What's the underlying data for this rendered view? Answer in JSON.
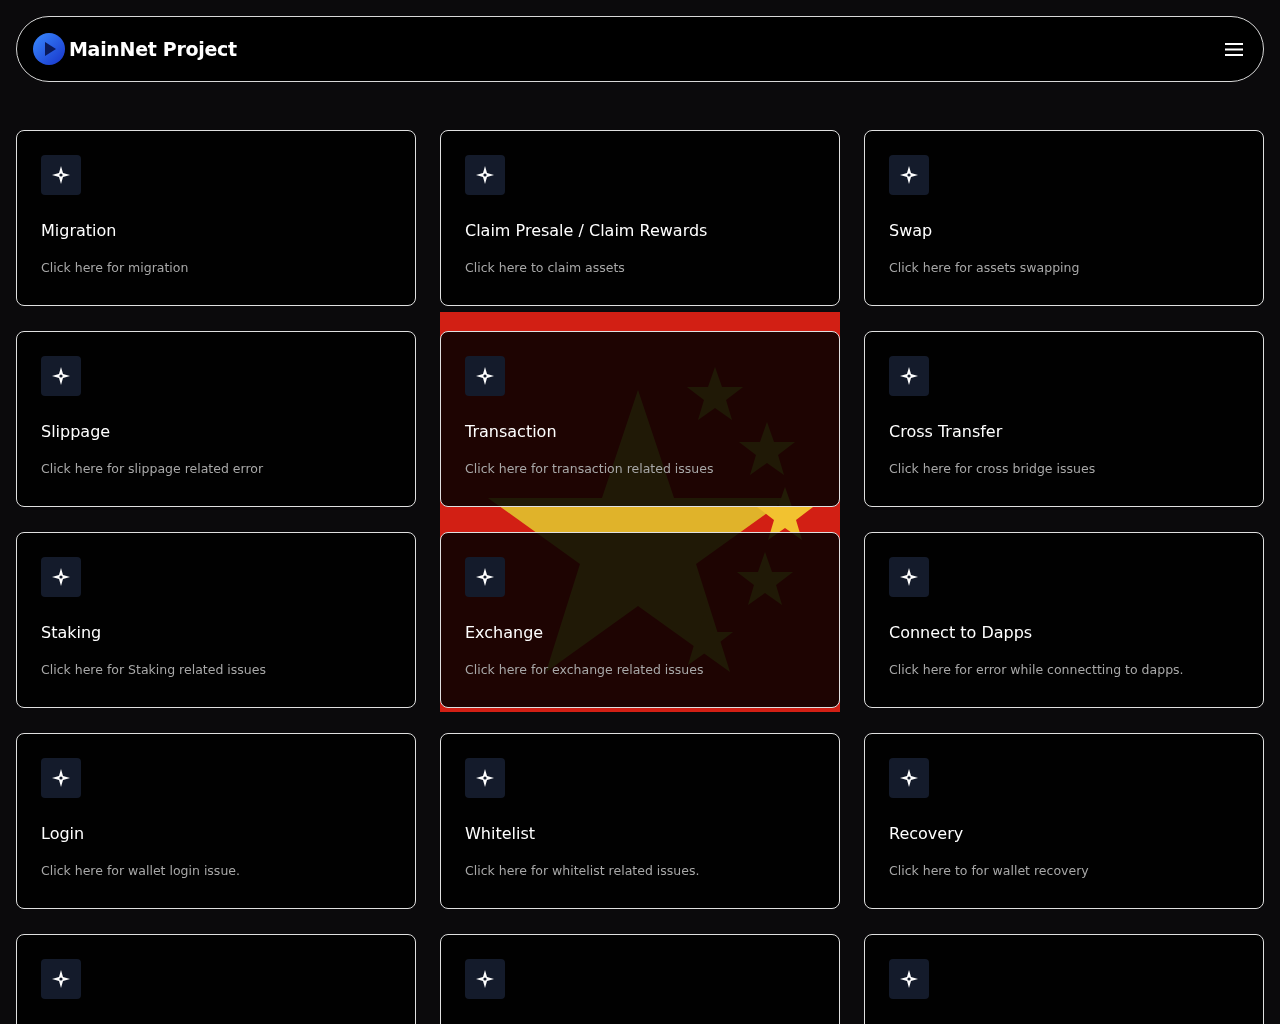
{
  "header": {
    "brand": "MainNet Project"
  },
  "cards": [
    {
      "kind": "text",
      "title": "Migration",
      "description": "Click here for migration"
    },
    {
      "kind": "text",
      "title": "Claim Presale / Claim Rewards",
      "description": "Click here to claim assets"
    },
    {
      "kind": "text",
      "title": "Swap",
      "description": "Click here for assets swapping"
    },
    {
      "kind": "text",
      "title": "Slippage",
      "description": "Click here for slippage related error"
    },
    {
      "kind": "text",
      "title": "Transaction",
      "description": "Click here for transaction related issues"
    },
    {
      "kind": "text",
      "title": "Cross Transfer",
      "description": "Click here for cross bridge issues"
    },
    {
      "kind": "text",
      "title": "Staking",
      "description": "Click here for Staking related issues"
    },
    {
      "kind": "text",
      "title": "Exchange",
      "description": "Click here for exchange related issues"
    },
    {
      "kind": "text",
      "title": "Connect to Dapps",
      "description": "Click here for error while connectting to dapps."
    },
    {
      "kind": "text",
      "title": "Login",
      "description": "Click here for wallet login issue."
    },
    {
      "kind": "text",
      "title": "Whitelist",
      "description": "Click here for whitelist related issues."
    },
    {
      "kind": "text",
      "title": "Recovery",
      "description": "Click here to for wallet recovery"
    },
    {
      "kind": "icon_only"
    },
    {
      "kind": "icon_only"
    },
    {
      "kind": "icon_only"
    }
  ]
}
